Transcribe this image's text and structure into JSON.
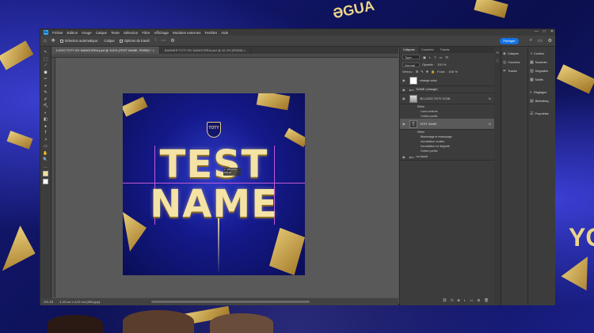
{
  "colors": {
    "accent": "#1473e6",
    "guide": "#c25bd4",
    "gold": "#f4e3a4",
    "bg_blue": "#151a7a"
  },
  "background": {
    "top_text": "ƏGUA",
    "right_text": "YO"
  },
  "window": {
    "menu": [
      "Ps",
      "Fichier",
      "Edition",
      "Image",
      "Calque",
      "Texte",
      "Sélection",
      "Filtre",
      "Affichage",
      "Modules externes",
      "Fenêtre",
      "Aide"
    ],
    "controls": [
      "—",
      "□",
      "✕"
    ]
  },
  "options": {
    "auto_select": "Sélection automatique :",
    "auto_select_target": "Calque",
    "transform_controls": "Options de transf.",
    "share": "Partager",
    "right_icons": [
      "search-icon",
      "window-icon",
      "settings-icon"
    ]
  },
  "tabs": [
    {
      "label": "LOGO TOTY BY NANOCREA.psd @ 101% (TEST NAME, RVB/8) *",
      "close": "×"
    },
    {
      "label": "BANNER TOTY BY NANOCREA.psd @ 42,4% (RVB/8)",
      "close": "×"
    }
  ],
  "tools": [
    "↖",
    "⬚",
    "⟋",
    "⬟",
    "✂",
    "⌖",
    "✎",
    "✐",
    "⛏",
    "◐",
    "◧",
    "●",
    "T",
    "↗",
    "▭",
    "✋",
    "🔍",
    "…"
  ],
  "artboard": {
    "crest_text": "TOTY",
    "line1": "TEST",
    "line2": "NAME",
    "tooltip": "L: 106 px\nH: 155 px"
  },
  "status": {
    "zoom": "101,53",
    "doc_info": "4,23 cm x 4,23 cm (300 ppp)"
  },
  "layers_panel": {
    "tabs": [
      "Calques",
      "Couches",
      "Tracés"
    ],
    "filter_label": "Type",
    "blend_mode": "Normal",
    "opacity_label": "Opacité :",
    "opacity_value": "100 %",
    "lock_label": "Verrou :",
    "fill_label": "Fond :",
    "fill_value": "100 %",
    "layers": [
      {
        "name": "change color",
        "kind": "image"
      },
      {
        "name": "NAME (change)",
        "kind": "folder"
      },
      {
        "name": "3D LOGO TOTY ICON",
        "kind": "image",
        "fx": "fx",
        "effects_label": "Effets",
        "effects": [
          "Lueur externe",
          "Ombre portée"
        ]
      },
      {
        "name": "TEST NAME",
        "kind": "text",
        "fx": "fx",
        "effects_label": "Effets",
        "effects": [
          "Biseautage et estampage",
          "Incrustation couleur",
          "Incrustation en dégradé",
          "Ombre portée"
        ]
      },
      {
        "name": "no touch",
        "kind": "folder"
      }
    ],
    "bottom_icons": [
      "link-icon",
      "fx-icon",
      "mask-icon",
      "adjust-icon",
      "folder-icon",
      "new-layer-icon",
      "trash-icon"
    ]
  },
  "side_panels": {
    "group1": [
      "Calques",
      "Couches",
      "Tracés"
    ],
    "group2": [
      "Couleur",
      "Nuancier",
      "Dégradés",
      "Motifs",
      "Réglages",
      "Bibliothèq...",
      "Propriétés"
    ]
  }
}
